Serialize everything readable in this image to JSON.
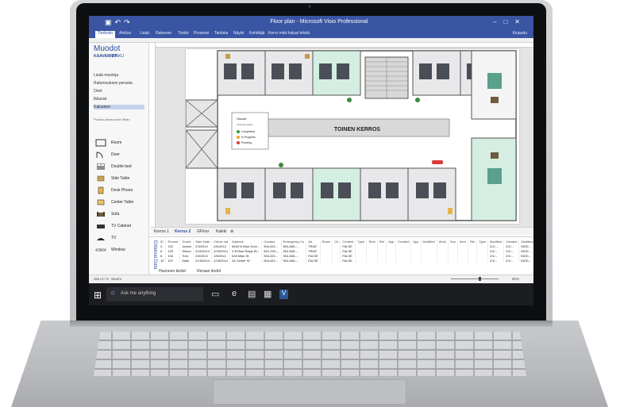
{
  "window": {
    "title": "Floor plan - Microsoft Visio Professional",
    "qat_icons": [
      "save-icon",
      "undo-icon",
      "redo-icon"
    ],
    "window_controls": [
      "minimize-icon",
      "maximize-icon",
      "close-icon"
    ]
  },
  "ribbon": {
    "tabs": [
      "Tiedosto",
      "Aloitus",
      "Lisää",
      "Rakenne",
      "Tiedot",
      "Prosessi",
      "Tarkista",
      "Näytä",
      "Kehittäjä"
    ],
    "active_tab": "Tiedosto",
    "tell_me": "Kerro mitä haluat tehdä",
    "user": "Kirjaudu"
  },
  "shapes_pane": {
    "header": "Muodot",
    "tab_stencils": "KAAVAIMET",
    "tab_search": "HAKU",
    "more_shapes": "Lisää muotoja",
    "collections": [
      "Rakennuksen perusta",
      "Ovet",
      "Ikkunat",
      "Kalusteet"
    ],
    "selected_collection": "Kalusteet",
    "hint": "Pudota pikamuodot tähän",
    "stencils": [
      {
        "label": "Room",
        "icon": "room-icon"
      },
      {
        "label": "Door",
        "icon": "door-icon"
      },
      {
        "label": "Double bed",
        "icon": "double-bed-icon"
      },
      {
        "label": "Side Table",
        "icon": "side-table-icon"
      },
      {
        "label": "Desk Phone",
        "icon": "desk-phone-icon"
      },
      {
        "label": "Center Table",
        "icon": "center-table-icon"
      },
      {
        "label": "Sofa",
        "icon": "sofa-icon"
      },
      {
        "label": "TV Cabinet",
        "icon": "tv-cabinet-icon"
      },
      {
        "label": "TV",
        "icon": "tv-icon"
      },
      {
        "label": "Window",
        "icon": "window-icon"
      }
    ]
  },
  "floorplan": {
    "banner": "TOINEN KERROS",
    "legend_title": "Vacant",
    "legend_subtitle": "Cleaning status",
    "legend_items": [
      {
        "label": "Completed",
        "color": "#2e9e3e"
      },
      {
        "label": "In Progress",
        "color": "#f0a020"
      },
      {
        "label": "Pending",
        "color": "#d83b3b"
      }
    ]
  },
  "page_tabs": {
    "tabs": [
      "Kerros 1",
      "Kerros 2",
      "GFloor",
      "Kaikki"
    ],
    "active": "Kerros 2",
    "add_icon": "add-page-icon"
  },
  "external_data": {
    "title": "External Data",
    "columns": [
      "ID",
      "Room#",
      "Guest",
      "Start Date",
      "Check out",
      "Address",
      "Contact",
      "Emergency Co",
      "Ad",
      "Room",
      "Ch",
      "Content",
      "Type",
      "Time",
      "Ref",
      "App",
      "Created",
      "App",
      "Modified",
      "Work",
      "Sou",
      "Item",
      "File",
      "Type",
      "Modified",
      "Created",
      "Modified",
      "URL",
      "Path",
      "Item Type"
    ],
    "rows": [
      [
        "4",
        "102",
        "James",
        "2/3/2014",
        "2/6/2014",
        "6649 N Blue Gum...",
        "504-621...",
        "504-845-...",
        "TRUE",
        "",
        "",
        "FALSE",
        "",
        "",
        "",
        "",
        "",
        "",
        "",
        "",
        "",
        "",
        "",
        "",
        "2/1/...",
        "2/1/...",
        "MOD...",
        "",
        "sites/...",
        "Item"
      ],
      [
        "6",
        "103",
        "Simon",
        "2/20/2014",
        "2/26/2014",
        "4 B Blue Ridge Bl...",
        "810-292-...",
        "504-845-...",
        "TRUE",
        "",
        "",
        "FALSE",
        "",
        "",
        "",
        "",
        "",
        "",
        "",
        "",
        "",
        "",
        "",
        "",
        "2/1/...",
        "2/1/...",
        "MOD...",
        "",
        "sites/...",
        "Item"
      ],
      [
        "8",
        "104",
        "Tom",
        "2/5/2014",
        "2/8/2014",
        "639 Main St",
        "504-621...",
        "504-845-...",
        "FALSE",
        "",
        "",
        "FALSE",
        "",
        "",
        "",
        "",
        "",
        "",
        "",
        "",
        "",
        "",
        "",
        "",
        "2/1/...",
        "2/1/...",
        "MOD...",
        "",
        "sites/...",
        "Item"
      ],
      [
        "10",
        "107",
        "Mark",
        "2/15/2014",
        "2/18/2014",
        "34 Center St",
        "504-621...",
        "504-845-...",
        "FALSE",
        "",
        "",
        "FALSE",
        "",
        "",
        "",
        "",
        "",
        "",
        "",
        "",
        "",
        "",
        "",
        "",
        "2/1/...",
        "2/1/...",
        "MOD...",
        "",
        "sites/...",
        "Item"
      ]
    ],
    "data_tabs": [
      "Huoneen tiedot",
      "Vieraan tiedot"
    ]
  },
  "status_bar": {
    "page": "Sivu 2 / 5",
    "language": "Suomi",
    "zoom": "52%",
    "zoom_level": 0.52
  },
  "taskbar": {
    "search_placeholder": "Ask me anything",
    "apps": [
      "task-view-icon",
      "edge-icon",
      "file-explorer-icon",
      "store-icon",
      "visio-icon"
    ]
  }
}
